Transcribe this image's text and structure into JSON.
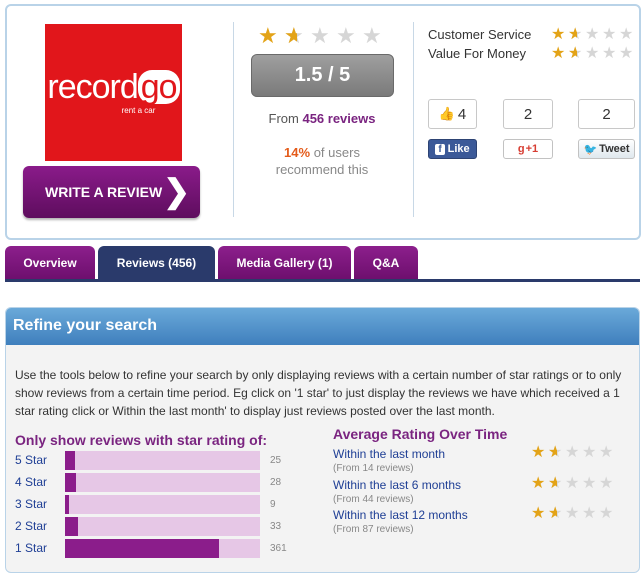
{
  "logo": {
    "brand_pre": "record",
    "brand_go": "go",
    "tagline": "rent a car"
  },
  "write_review": {
    "label": "WRITE A REVIEW",
    "chevron": "❯"
  },
  "rating": {
    "stars": 1.5,
    "score_text": "1.5 / 5",
    "from_prefix": "From",
    "review_link": "456 reviews",
    "pct": "14%",
    "pct_suffix_1": "of users",
    "pct_suffix_2": "recommend this"
  },
  "categories": [
    {
      "label": "Customer Service",
      "stars": 1.5
    },
    {
      "label": "Value For Money",
      "stars": 1.5
    }
  ],
  "social": {
    "facebook": {
      "count": "4",
      "label": "Like"
    },
    "google": {
      "count": "2",
      "label": "+1"
    },
    "twitter": {
      "count": "2",
      "label": "Tweet"
    }
  },
  "tabs": [
    {
      "label": "Overview",
      "active": false
    },
    {
      "label": "Reviews (456)",
      "active": true
    },
    {
      "label": "Media Gallery (1)",
      "active": false
    },
    {
      "label": "Q&A",
      "active": false
    }
  ],
  "refine": {
    "title": "Refine your search",
    "description": "Use the tools below to refine your search by only displaying reviews with a certain number of star ratings or to only show reviews from a certain time period. Eg click on '1 star' to just display the reviews we have which received a 1 star rating click or Within the last month' to display just reviews posted over the last month.",
    "star_heading": "Only show reviews with star rating of:",
    "time_heading": "Average Rating Over Time"
  },
  "star_filters": [
    {
      "label": "5 Star",
      "count": "25",
      "fraction": 0.05
    },
    {
      "label": "4 Star",
      "count": "28",
      "fraction": 0.055
    },
    {
      "label": "3 Star",
      "count": "9",
      "fraction": 0.018
    },
    {
      "label": "2 Star",
      "count": "33",
      "fraction": 0.065
    },
    {
      "label": "1 Star",
      "count": "361",
      "fraction": 0.79
    }
  ],
  "time_filters": [
    {
      "label": "Within the last month",
      "sub": "(From 14 reviews)",
      "stars": 1.5
    },
    {
      "label": "Within the last 6 months",
      "sub": "(From 44 reviews)",
      "stars": 1.5
    },
    {
      "label": "Within the last 12 months",
      "sub": "(From 87 reviews)",
      "stars": 1.5
    }
  ],
  "colors": {
    "brand_purple": "#7a2480",
    "logo_red": "#e1161b",
    "star_gold": "#e3a317",
    "link_blue": "#1f3f95",
    "header_blue": "#4a8ac7"
  }
}
